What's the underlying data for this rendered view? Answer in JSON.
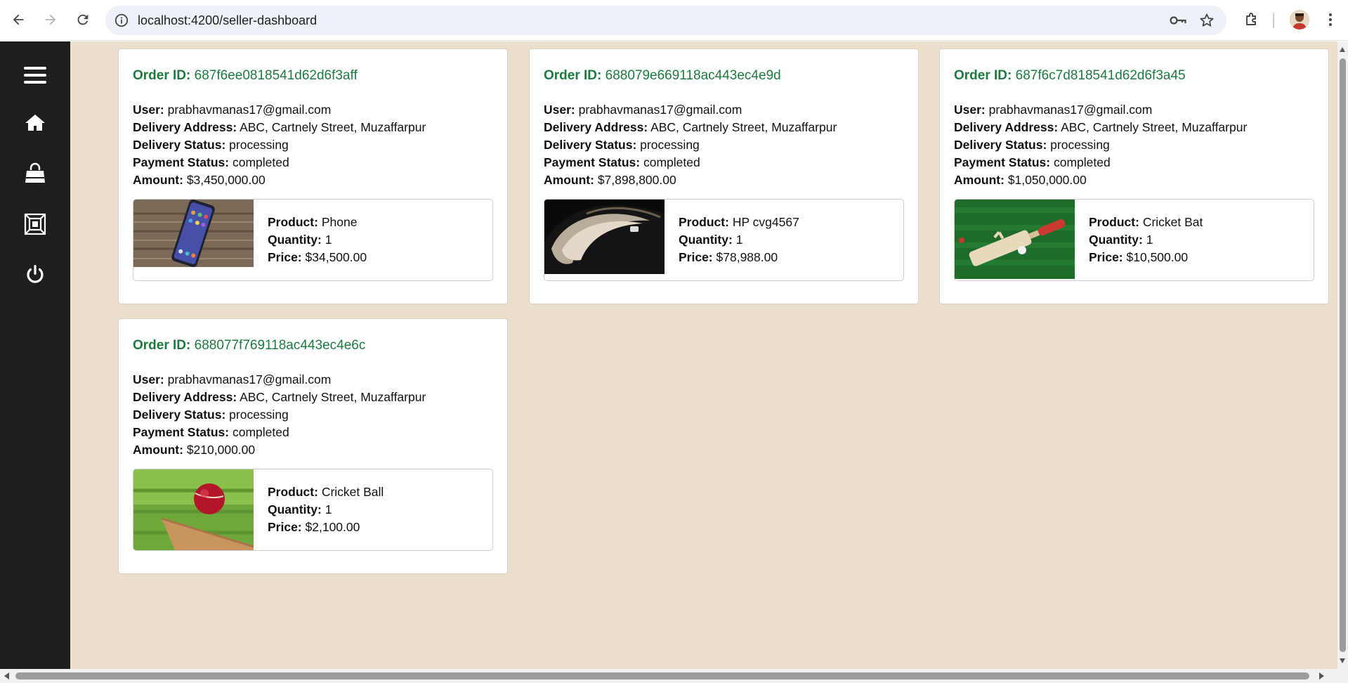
{
  "browser": {
    "url": "localhost:4200/seller-dashboard"
  },
  "sidebar": {
    "items": [
      {
        "name": "menu-icon"
      },
      {
        "name": "home-icon"
      },
      {
        "name": "shopping-bag-icon"
      },
      {
        "name": "products-icon"
      },
      {
        "name": "power-icon"
      }
    ]
  },
  "labels": {
    "order_id": "Order ID:",
    "user": "User:",
    "delivery_address": "Delivery Address:",
    "delivery_status": "Delivery Status:",
    "payment_status": "Payment Status:",
    "amount": "Amount:",
    "product": "Product:",
    "quantity": "Quantity:",
    "price": "Price:"
  },
  "orders": [
    {
      "id": "687f6ee0818541d62d6f3aff",
      "user": "prabhavmanas17@gmail.com",
      "delivery_address": "ABC, Cartnely Street, Muzaffarpur",
      "delivery_status": "processing",
      "payment_status": "completed",
      "amount": "$3,450,000.00",
      "item": {
        "product": "Phone",
        "quantity": "1",
        "price": "$34,500.00",
        "image": "phone-image"
      }
    },
    {
      "id": "688079e669118ac443ec4e9d",
      "user": "prabhavmanas17@gmail.com",
      "delivery_address": "ABC, Cartnely Street, Muzaffarpur",
      "delivery_status": "processing",
      "payment_status": "completed",
      "amount": "$7,898,800.00",
      "item": {
        "product": "HP cvg4567",
        "quantity": "1",
        "price": "$78,988.00",
        "image": "laptop-image"
      }
    },
    {
      "id": "687f6c7d818541d62d6f3a45",
      "user": "prabhavmanas17@gmail.com",
      "delivery_address": "ABC, Cartnely Street, Muzaffarpur",
      "delivery_status": "processing",
      "payment_status": "completed",
      "amount": "$1,050,000.00",
      "item": {
        "product": "Cricket Bat",
        "quantity": "1",
        "price": "$10,500.00",
        "image": "cricket-bat-image"
      }
    },
    {
      "id": "688077f769118ac443ec4e6c",
      "user": "prabhavmanas17@gmail.com",
      "delivery_address": "ABC, Cartnely Street, Muzaffarpur",
      "delivery_status": "processing",
      "payment_status": "completed",
      "amount": "$210,000.00",
      "item": {
        "product": "Cricket Ball",
        "quantity": "1",
        "price": "$2,100.00",
        "image": "cricket-ball-image"
      }
    }
  ],
  "colors": {
    "sidebar_bg": "#1c1f1b",
    "main_bg": "#ebdfcc",
    "order_id": "#1c7a3e"
  }
}
